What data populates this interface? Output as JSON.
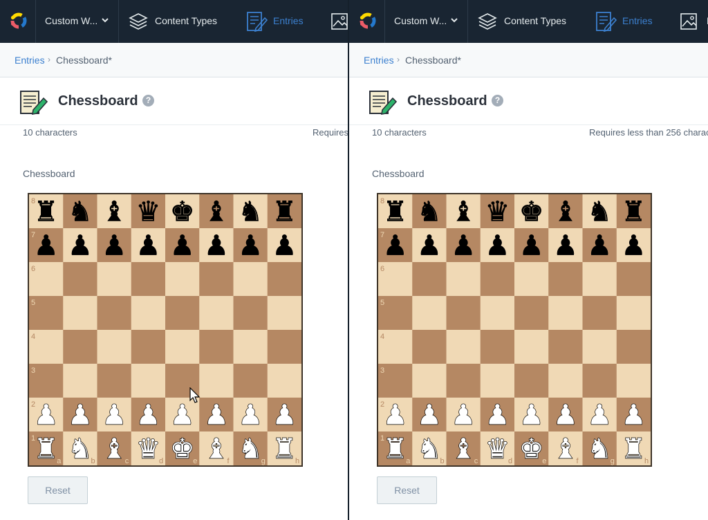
{
  "app": {
    "space_name": "Custom W...",
    "nav": {
      "content_types": "Content Types",
      "entries": "Entries",
      "media_partial": "M"
    },
    "breadcrumb": {
      "parent": "Entries",
      "separator": "›",
      "current": "Chessboard*"
    },
    "entry": {
      "title": "Chessboard",
      "help": "?",
      "char_count": "10 characters",
      "requirement_left": "Requires",
      "requirement_right": "Requires less than 256 charac",
      "field_label": "Chessboard"
    },
    "reset_label": "Reset",
    "colors": {
      "topbar": "#192532",
      "accent": "#3c80cf",
      "board_light": "#f0d9b5",
      "board_dark": "#b58863"
    }
  },
  "board": {
    "ranks": [
      "8",
      "7",
      "6",
      "5",
      "4",
      "3",
      "2",
      "1"
    ],
    "files": [
      "a",
      "b",
      "c",
      "d",
      "e",
      "f",
      "g",
      "h"
    ],
    "position": [
      [
        "r",
        "n",
        "b",
        "q",
        "k",
        "b",
        "n",
        "r"
      ],
      [
        "p",
        "p",
        "p",
        "p",
        "p",
        "p",
        "p",
        "p"
      ],
      [
        "",
        "",
        "",
        "",
        "",
        "",
        "",
        ""
      ],
      [
        "",
        "",
        "",
        "",
        "",
        "",
        "",
        ""
      ],
      [
        "",
        "",
        "",
        "",
        "",
        "",
        "",
        ""
      ],
      [
        "",
        "",
        "",
        "",
        "",
        "",
        "",
        ""
      ],
      [
        "P",
        "P",
        "P",
        "P",
        "P",
        "P",
        "P",
        "P"
      ],
      [
        "R",
        "N",
        "B",
        "Q",
        "K",
        "B",
        "N",
        "R"
      ]
    ],
    "glyphs": {
      "k": "♚",
      "q": "♛",
      "r": "♜",
      "b": "♝",
      "n": "♞",
      "p": "♟",
      "K": "♚",
      "Q": "♛",
      "R": "♜",
      "B": "♝",
      "N": "♞",
      "P": "♟"
    }
  }
}
